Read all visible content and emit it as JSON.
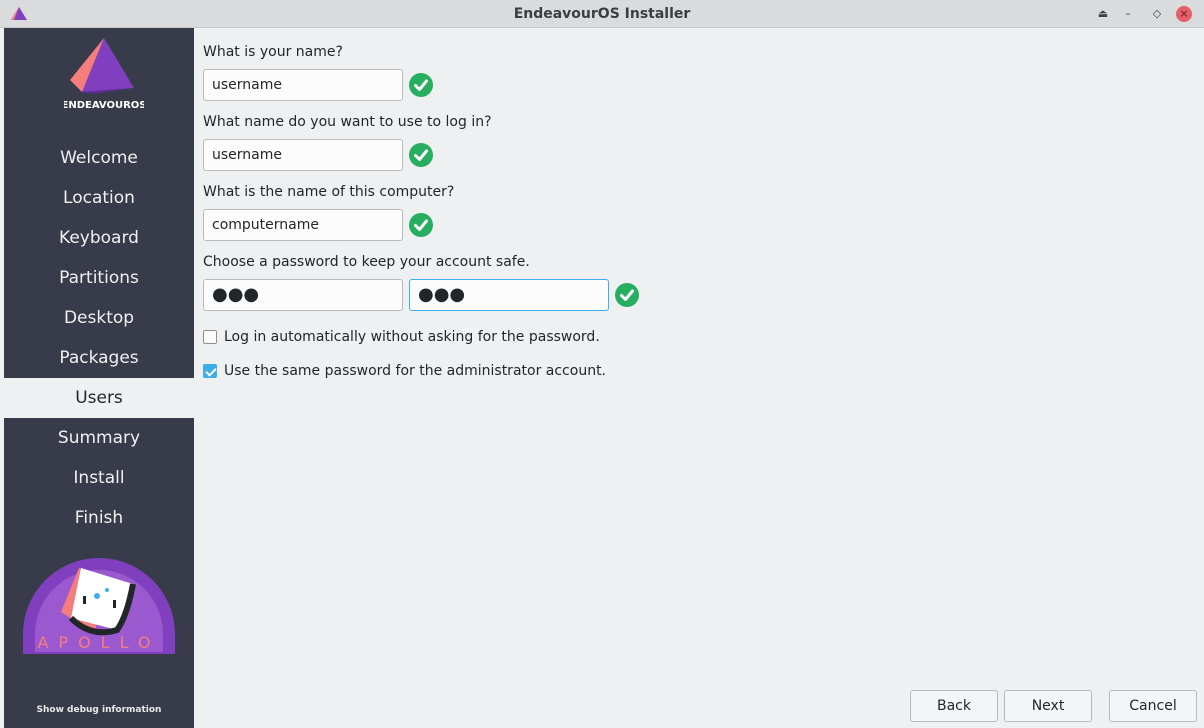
{
  "window": {
    "title": "EndeavourOS Installer",
    "controls": {
      "keep_above": "⏏",
      "minimize": "–",
      "maximize": "◇",
      "close": "×"
    }
  },
  "sidebar": {
    "logo_text": "ENDEAVOUROS",
    "items": [
      {
        "label": "Welcome"
      },
      {
        "label": "Location"
      },
      {
        "label": "Keyboard"
      },
      {
        "label": "Partitions"
      },
      {
        "label": "Desktop"
      },
      {
        "label": "Packages"
      },
      {
        "label": "Users"
      },
      {
        "label": "Summary"
      },
      {
        "label": "Install"
      },
      {
        "label": "Finish"
      }
    ],
    "active_item": "Users",
    "badge_text": "APOLLO",
    "debug_label": "Show debug information"
  },
  "form": {
    "name": {
      "label": "What is your name?",
      "value": "username"
    },
    "login": {
      "label": "What name do you want to use to log in?",
      "value": "username"
    },
    "hostname": {
      "label": "What is the name of this computer?",
      "value": "computername"
    },
    "password": {
      "label": "Choose a password to keep your account safe.",
      "value": "●●●",
      "confirm_value": "●●●"
    },
    "autologin": {
      "label": "Log in automatically without asking for the password.",
      "checked": false
    },
    "same_admin_password": {
      "label": "Use the same password for the administrator account.",
      "checked": true
    }
  },
  "buttons": {
    "back": "Back",
    "next": "Next",
    "cancel": "Cancel"
  },
  "colors": {
    "sidebar_bg": "#383c4a",
    "window_bg": "#eff0f1",
    "accent": "#3daee9",
    "valid_green": "#27ae60",
    "close_red": "#e55e6a",
    "logo_purple": "#7f3fbf",
    "logo_coral": "#f67d7d"
  },
  "icons": {
    "valid": "check-circle-icon",
    "app": "endeavouros-logo-icon"
  }
}
